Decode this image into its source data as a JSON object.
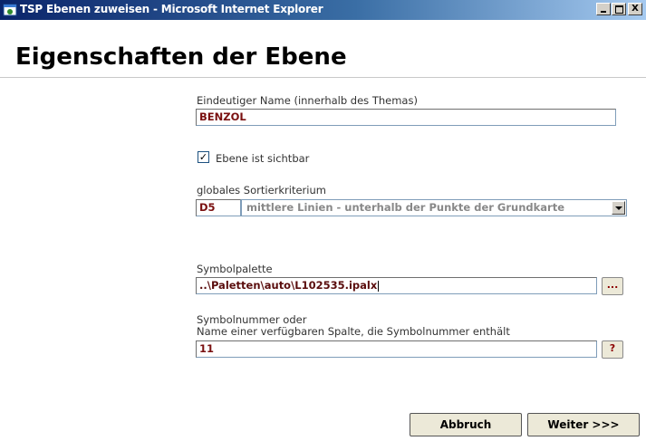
{
  "window": {
    "title": "TSP Ebenen zuweisen - Microsoft Internet Explorer",
    "minimize": "",
    "maximize": "",
    "close": "X"
  },
  "page": {
    "title": "Eigenschaften der Ebene"
  },
  "form": {
    "name_label": "Eindeutiger Name (innerhalb des Themas)",
    "name_value": "BENZOL",
    "visible_label": "Ebene ist sichtbar",
    "visible_checked": "✓",
    "sort_label": "globales Sortierkriterium",
    "sort_code": "D5",
    "sort_selected": "mittlere Linien - unterhalb der Punkte der Grundkarte",
    "palette_label": "Symbolpalette",
    "palette_value": "..\\Paletten\\auto\\L102535.ipalx",
    "palette_browse": "...",
    "symbol_label_line1": "Symbolnummer oder",
    "symbol_label_line2": "Name einer verfügbaren Spalte, die Symbolnummer enthält",
    "symbol_value": "11",
    "symbol_help": "?"
  },
  "buttons": {
    "cancel": "Abbruch",
    "next": "Weiter >>>"
  }
}
